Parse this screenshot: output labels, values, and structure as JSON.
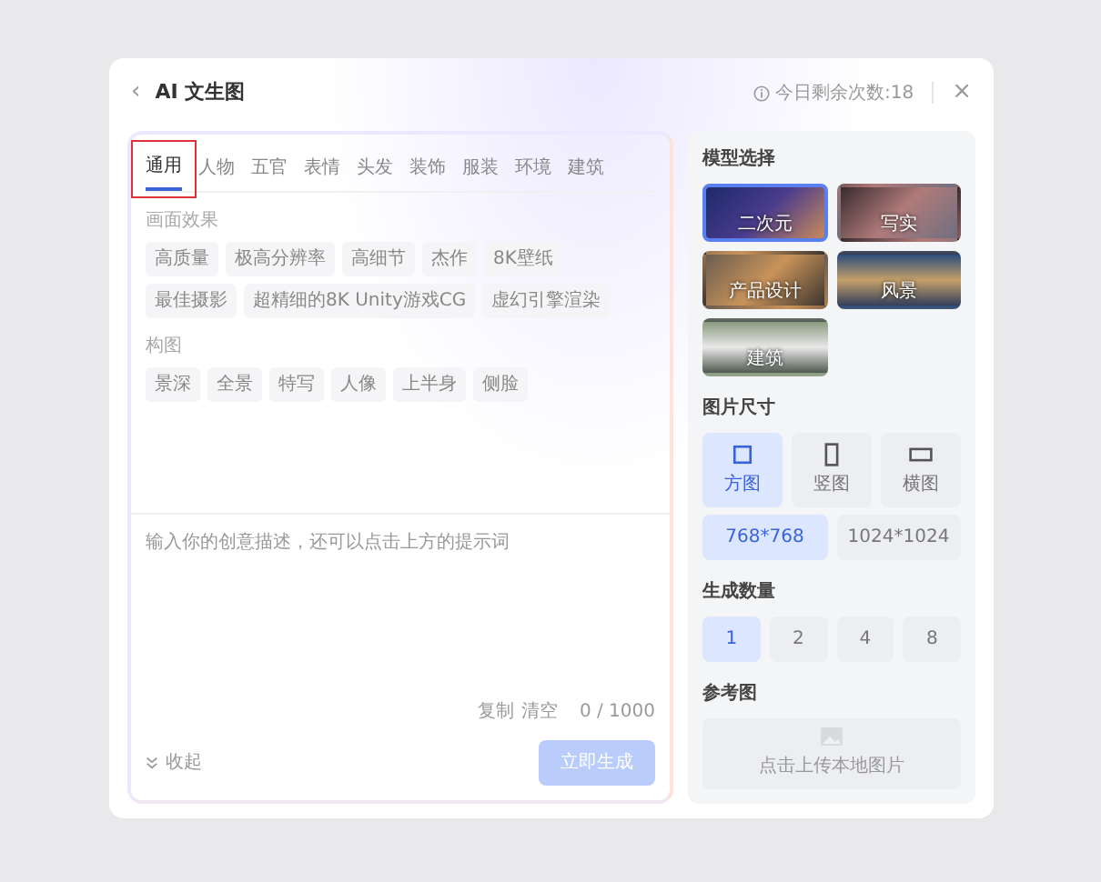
{
  "dialog": {
    "back_icon": "‹",
    "title": "AI 文生图",
    "remaining": "今日剩余次数:18",
    "close": "×"
  },
  "prompt_panel": {
    "tabs": [
      {
        "label": "通用",
        "selected": true
      },
      {
        "label": "人物",
        "selected": false
      },
      {
        "label": "五官",
        "selected": false
      },
      {
        "label": "表情",
        "selected": false
      },
      {
        "label": "头发",
        "selected": false
      },
      {
        "label": "装饰",
        "selected": false
      },
      {
        "label": "服装",
        "selected": false
      },
      {
        "label": "环境",
        "selected": false
      },
      {
        "label": "建筑",
        "selected": false
      }
    ],
    "sections": [
      {
        "title": "画面效果",
        "tags": [
          "高质量",
          "极高分辨率",
          "高细节",
          "杰作",
          "8K壁纸",
          "最佳摄影",
          "超精细的8K Unity游戏CG",
          "虚幻引擎渲染"
        ]
      },
      {
        "title": "构图",
        "tags": [
          "景深",
          "全景",
          "特写",
          "人像",
          "上半身",
          "侧脸"
        ]
      }
    ],
    "input": {
      "placeholder": "输入你的创意描述，还可以点击上方的提示词"
    },
    "copy": "复制",
    "clear": "清空",
    "counter": "0 / 1000",
    "collapse": "收起",
    "generate": {
      "label": "立即生成",
      "disabled": true
    }
  },
  "settings_panel": {
    "model_title": "模型选择",
    "models": [
      {
        "label": "二次元",
        "selected": true
      },
      {
        "label": "写实",
        "selected": false
      },
      {
        "label": "产品设计",
        "selected": false
      },
      {
        "label": "风景",
        "selected": false
      },
      {
        "label": "建筑",
        "selected": false
      }
    ],
    "size_title": "图片尺寸",
    "shapes": [
      {
        "label": "方图",
        "kind": "square",
        "selected": true
      },
      {
        "label": "竖图",
        "kind": "portrait",
        "selected": false
      },
      {
        "label": "横图",
        "kind": "landscape",
        "selected": false
      }
    ],
    "resolutions": [
      {
        "label": "768*768",
        "selected": true
      },
      {
        "label": "1024*1024",
        "selected": false
      }
    ],
    "count_title": "生成数量",
    "counts": [
      {
        "label": "1",
        "selected": true
      },
      {
        "label": "2",
        "selected": false
      },
      {
        "label": "4",
        "selected": false
      },
      {
        "label": "8",
        "selected": false
      }
    ],
    "reference_title": "参考图",
    "upload": "点击上传本地图片"
  }
}
